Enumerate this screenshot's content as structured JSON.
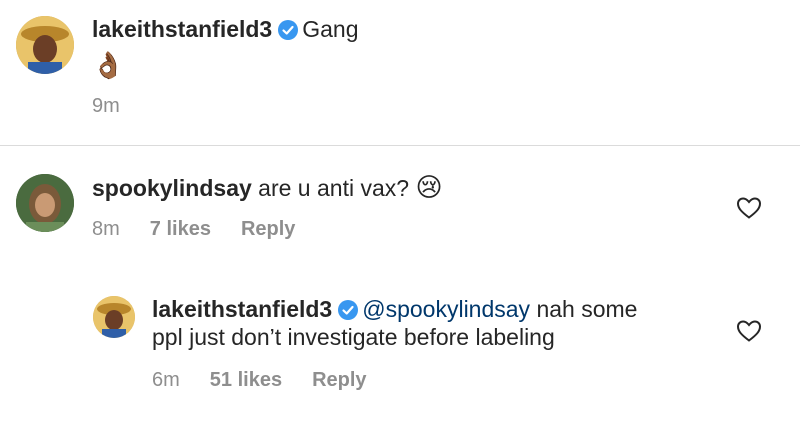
{
  "caption": {
    "username": "lakeithstanfield3",
    "text": "Gang",
    "emoji": "👌🏾",
    "time": "9m"
  },
  "comment": {
    "username": "spookylindsay",
    "text": "are u anti vax?",
    "emoji": "😢",
    "time": "8m",
    "likes": "7 likes",
    "reply": "Reply"
  },
  "reply": {
    "username": "lakeithstanfield3",
    "mention": "@spookylindsay",
    "text_line1": " nah some",
    "text_line2": "ppl just don’t investigate before labeling",
    "time": "6m",
    "likes": "51 likes",
    "reply": "Reply"
  },
  "colors": {
    "verified": "#3897f0",
    "mention": "#00376b",
    "meta": "#8e8e8e"
  }
}
